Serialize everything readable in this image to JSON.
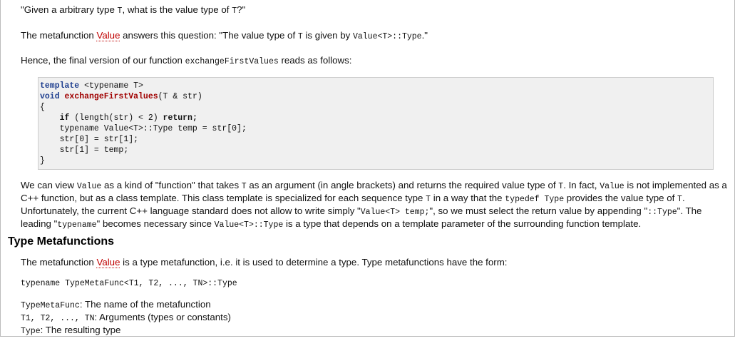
{
  "intro_question": "\"Given a arbitrary type ",
  "intro_question_T": "T",
  "intro_question_mid": ", what is the value type of ",
  "intro_question_T2": "T",
  "intro_question_end": "?\"",
  "p1_a": "The metafunction ",
  "p1_link": "Value",
  "p1_b": " answers this question: \"The value type of ",
  "p1_T": "T",
  "p1_c": " is given by ",
  "p1_code": "Value<T>::Type",
  "p1_d": ".\"",
  "p2_a": "Hence, the final version of our function ",
  "p2_code": "exchangeFirstValues",
  "p2_b": " reads as follows:",
  "code": {
    "l1_kw": "template",
    "l1_rest": " <typename T>",
    "l2_kw": "void",
    "l2_sp": " ",
    "l2_fn": "exchangeFirstValues",
    "l2_rest": "(T & str)",
    "l3": "{",
    "l4_indent": "    ",
    "l4_if": "if",
    "l4_mid": " (length(str) < 2) ",
    "l4_ret": "return;",
    "l5": "    typename Value<T>::Type temp = str[0];",
    "l6": "    str[0] = str[1];",
    "l7": "    str[1] = temp;",
    "l8": "}"
  },
  "p3": {
    "a": "We can view ",
    "c1": "Value",
    "b": " as a kind of \"function\" that takes ",
    "c2": "T",
    "c": " as an argument (in angle brackets) and returns the required value type of ",
    "c3": "T",
    "d": ". In fact, ",
    "c4": "Value",
    "e": " is not implemented as a C++ function, but as a class template. This class template is specialized for each sequence type ",
    "c5": "T",
    "f": " in a way that the ",
    "c6": "typedef Type",
    "g": " provides the value type of ",
    "c7": "T",
    "h": ". Unfortunately, the current C++ language standard does not allow to write simply \"",
    "c8": "Value<T> temp;",
    "i": "\", so we must select the return value by appending \"",
    "c9": "::Type",
    "j": "\". The leading \"",
    "c10": "typename",
    "k": "\" becomes necessary since ",
    "c11": "Value<T>::Type",
    "l": " is a type that depends on a template parameter of the surrounding function template."
  },
  "heading": "Type Metafunctions",
  "p4_a": "The metafunction ",
  "p4_link": "Value",
  "p4_b": " is a type metafunction, i.e. it is used to determine a type. Type metafunctions have the form:",
  "form_code": "typename TypeMetaFunc<T1, T2, ..., TN>::Type",
  "defs": [
    {
      "term": "TypeMetaFunc",
      "desc": ": The name of the metafunction"
    },
    {
      "term": "T1, T2, ..., TN",
      "desc": ": Arguments (types or constants)"
    },
    {
      "term": "Type",
      "desc": ": The resulting type"
    }
  ]
}
